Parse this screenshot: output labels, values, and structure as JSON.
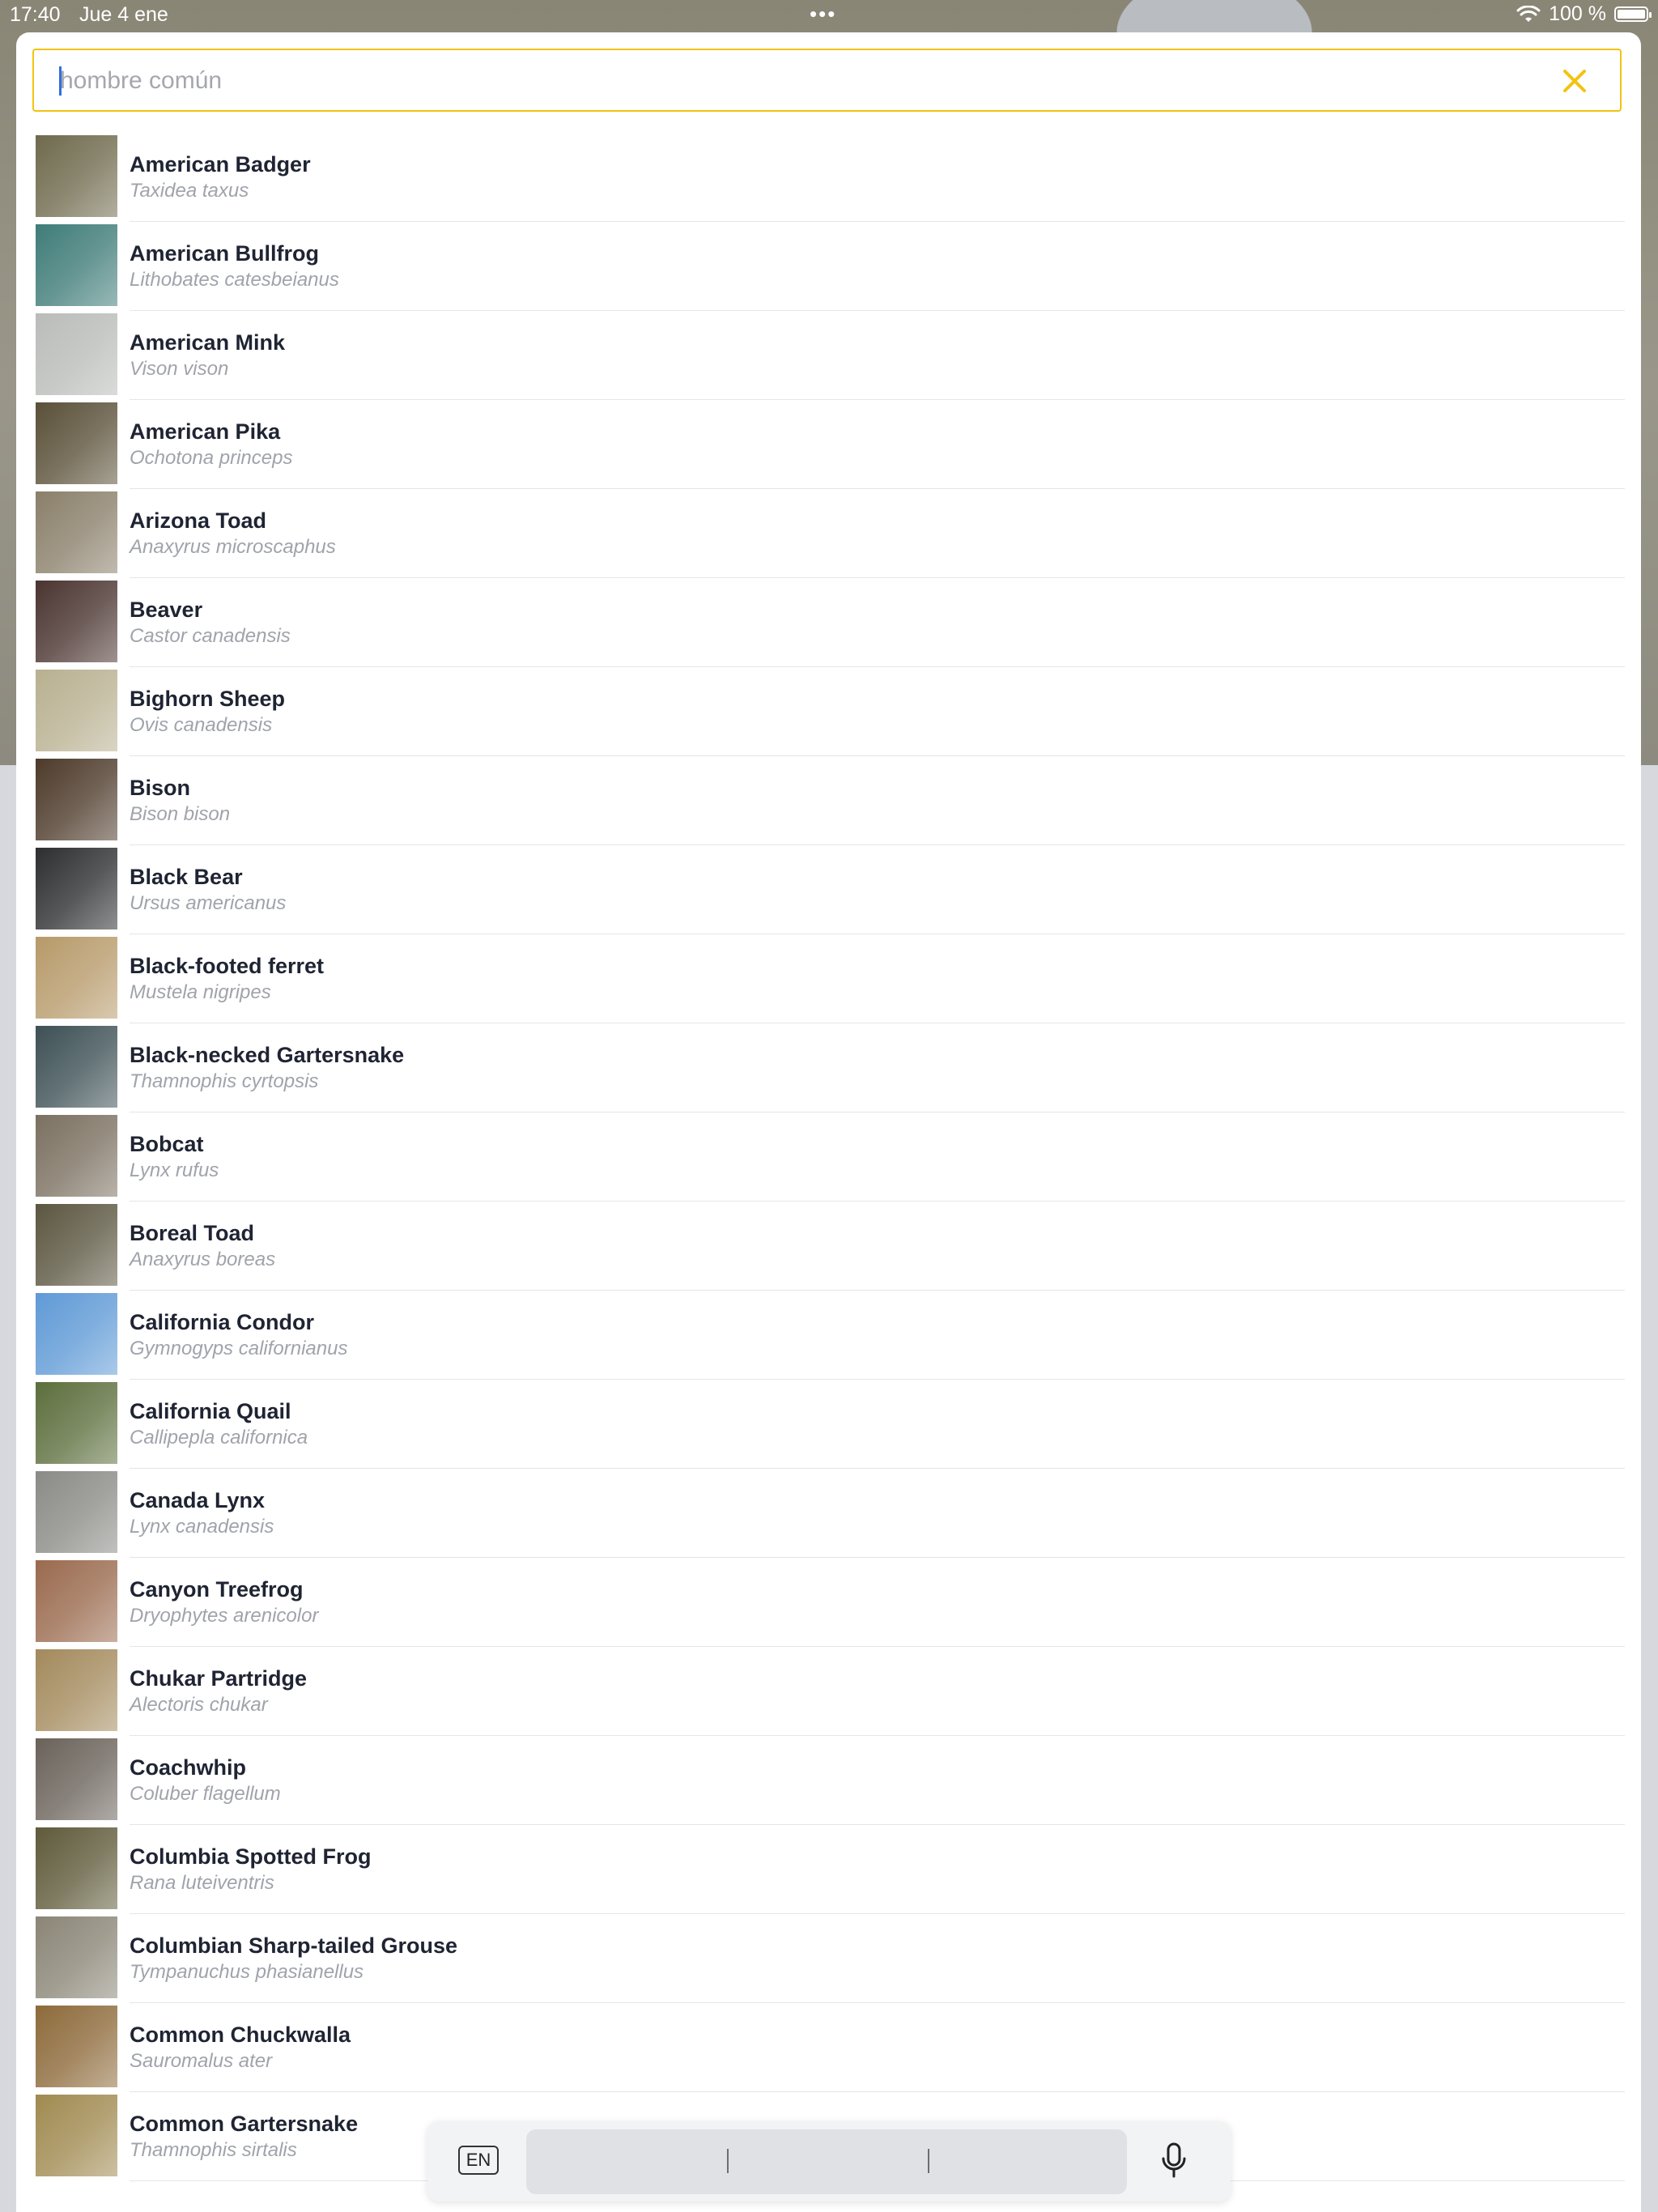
{
  "status_bar": {
    "time": "17:40",
    "date": "Jue 4 ene",
    "battery": "100 %"
  },
  "search": {
    "placeholder": "hombre común",
    "value": ""
  },
  "colors": {
    "accent": "#f2c311",
    "title": "#1f2433",
    "subtitle": "#a0a3ab"
  },
  "species": [
    {
      "name": "American Badger",
      "scientific": "Taxidea taxus",
      "thumb": "#6f6a4d"
    },
    {
      "name": "American Bullfrog",
      "scientific": "Lithobates catesbeianus",
      "thumb": "#3f7c78"
    },
    {
      "name": "American Mink",
      "scientific": "Vison vison",
      "thumb": "#b9bcb8"
    },
    {
      "name": "American Pika",
      "scientific": "Ochotona princeps",
      "thumb": "#5a5038"
    },
    {
      "name": "Arizona Toad",
      "scientific": "Anaxyrus microscaphus",
      "thumb": "#8a7f6a"
    },
    {
      "name": "Beaver",
      "scientific": "Castor canadensis",
      "thumb": "#4a3430"
    },
    {
      "name": "Bighorn Sheep",
      "scientific": "Ovis canadensis",
      "thumb": "#b8b090"
    },
    {
      "name": "Bison",
      "scientific": "Bison bison",
      "thumb": "#4d3a2a"
    },
    {
      "name": "Black Bear",
      "scientific": "Ursus americanus",
      "thumb": "#2c2e30"
    },
    {
      "name": "Black-footed ferret",
      "scientific": "Mustela nigripes",
      "thumb": "#b79a6a"
    },
    {
      "name": "Black-necked Gartersnake",
      "scientific": "Thamnophis cyrtopsis",
      "thumb": "#3d5055"
    },
    {
      "name": "Bobcat",
      "scientific": "Lynx rufus",
      "thumb": "#7b7060"
    },
    {
      "name": "Boreal Toad",
      "scientific": "Anaxyrus boreas",
      "thumb": "#5b5640"
    },
    {
      "name": "California Condor",
      "scientific": "Gymnogyps californianus",
      "thumb": "#5f9ad6"
    },
    {
      "name": "California Quail",
      "scientific": "Callipepla californica",
      "thumb": "#5c6e3c"
    },
    {
      "name": "Canada Lynx",
      "scientific": "Lynx canadensis",
      "thumb": "#8a8a86"
    },
    {
      "name": "Canyon Treefrog",
      "scientific": "Dryophytes arenicolor",
      "thumb": "#9a6a4e"
    },
    {
      "name": "Chukar Partridge",
      "scientific": "Alectoris chukar",
      "thumb": "#a38a5c"
    },
    {
      "name": "Coachwhip",
      "scientific": "Coluber flagellum",
      "thumb": "#6a625a"
    },
    {
      "name": "Columbia Spotted Frog",
      "scientific": "Rana luteiventris",
      "thumb": "#5f5a3a"
    },
    {
      "name": "Columbian Sharp-tailed Grouse",
      "scientific": "Tympanuchus phasianellus",
      "thumb": "#8a8576"
    },
    {
      "name": "Common Chuckwalla",
      "scientific": "Sauromalus ater",
      "thumb": "#8d6a3a"
    },
    {
      "name": "Common Gartersnake",
      "scientific": "Thamnophis sirtalis",
      "thumb": "#a08a50"
    }
  ],
  "keyboard": {
    "language": "EN"
  }
}
